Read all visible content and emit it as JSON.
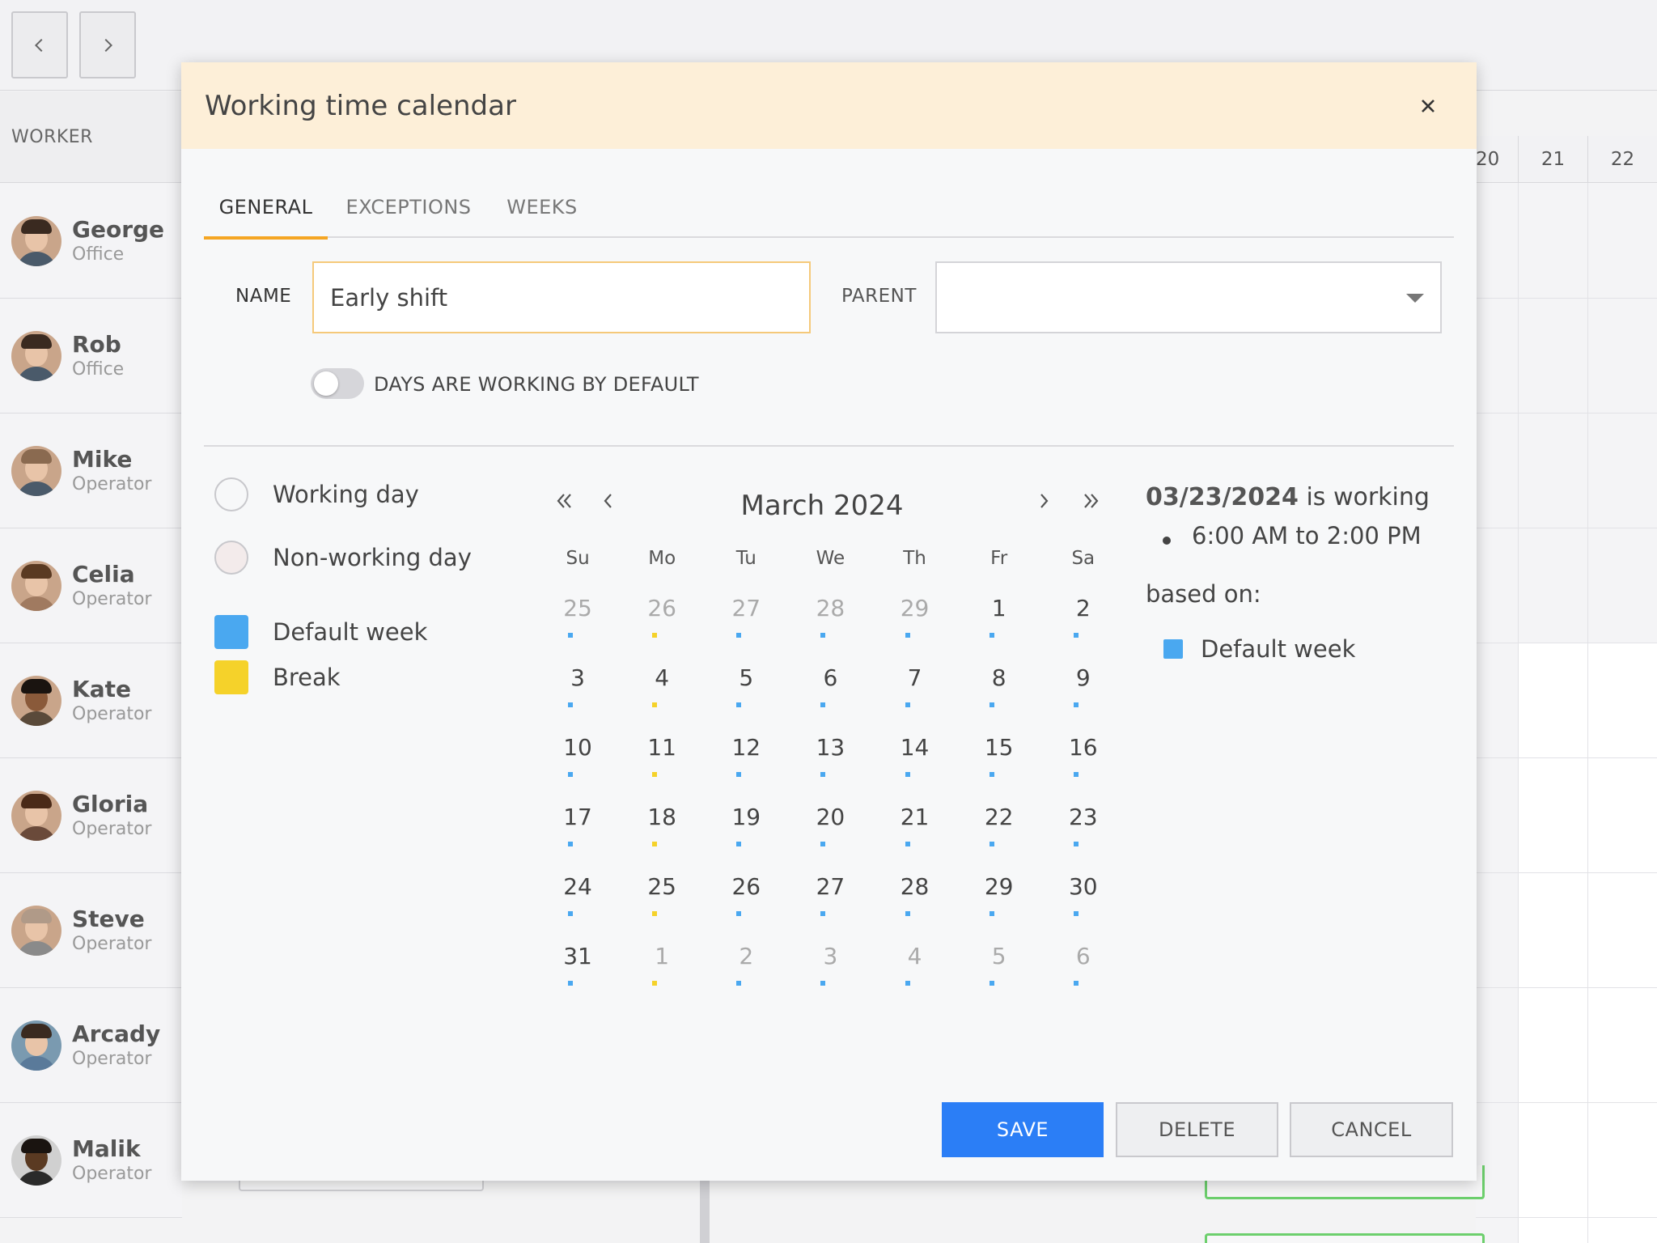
{
  "scheduler": {
    "worker_header": "WORKER",
    "date_headers": [
      "20",
      "21",
      "22"
    ],
    "workers": [
      {
        "name": "George",
        "role": "Office"
      },
      {
        "name": "Rob",
        "role": "Office"
      },
      {
        "name": "Mike",
        "role": "Operator"
      },
      {
        "name": "Celia",
        "role": "Operator"
      },
      {
        "name": "Kate",
        "role": "Operator"
      },
      {
        "name": "Gloria",
        "role": "Operator"
      },
      {
        "name": "Steve",
        "role": "Operator"
      },
      {
        "name": "Arcady",
        "role": "Operator"
      },
      {
        "name": "Malik",
        "role": "Operator"
      }
    ]
  },
  "dialog": {
    "title": "Working time calendar",
    "tabs": [
      "GENERAL",
      "EXCEPTIONS",
      "WEEKS"
    ],
    "active_tab": "GENERAL",
    "name_label": "NAME",
    "name_value": "Early shift",
    "parent_label": "PARENT",
    "parent_value": "",
    "toggle_label": "DAYS ARE WORKING BY DEFAULT",
    "toggle_on": false,
    "legend": {
      "working_day": "Working day",
      "non_working_day": "Non-working day",
      "default_week": "Default week",
      "break": "Break"
    },
    "colors": {
      "default_week": "#4aa8f0",
      "break": "#f5d22a",
      "accent": "#f5a623",
      "save": "#2b7ef6",
      "header_bg": "#fdefd8"
    },
    "calendar": {
      "month_title": "March 2024",
      "days_of_week": [
        "Su",
        "Mo",
        "Tu",
        "We",
        "Th",
        "Fr",
        "Sa"
      ],
      "weeks": [
        [
          {
            "d": "25",
            "other": true
          },
          {
            "d": "26",
            "other": true
          },
          {
            "d": "27",
            "other": true
          },
          {
            "d": "28",
            "other": true
          },
          {
            "d": "29",
            "other": true
          },
          {
            "d": "1"
          },
          {
            "d": "2"
          }
        ],
        [
          {
            "d": "3"
          },
          {
            "d": "4"
          },
          {
            "d": "5"
          },
          {
            "d": "6"
          },
          {
            "d": "7"
          },
          {
            "d": "8"
          },
          {
            "d": "9"
          }
        ],
        [
          {
            "d": "10"
          },
          {
            "d": "11"
          },
          {
            "d": "12"
          },
          {
            "d": "13"
          },
          {
            "d": "14"
          },
          {
            "d": "15"
          },
          {
            "d": "16"
          }
        ],
        [
          {
            "d": "17"
          },
          {
            "d": "18"
          },
          {
            "d": "19"
          },
          {
            "d": "20"
          },
          {
            "d": "21"
          },
          {
            "d": "22"
          },
          {
            "d": "23"
          }
        ],
        [
          {
            "d": "24"
          },
          {
            "d": "25"
          },
          {
            "d": "26"
          },
          {
            "d": "27"
          },
          {
            "d": "28"
          },
          {
            "d": "29"
          },
          {
            "d": "30"
          }
        ],
        [
          {
            "d": "31"
          },
          {
            "d": "1",
            "other": true
          },
          {
            "d": "2",
            "other": true
          },
          {
            "d": "3",
            "other": true
          },
          {
            "d": "4",
            "other": true
          },
          {
            "d": "5",
            "other": true
          },
          {
            "d": "6",
            "other": true
          }
        ]
      ],
      "break_column": "Mo"
    },
    "info": {
      "date": "03/23/2024",
      "date_suffix": " is working",
      "time_range": "6:00 AM to 2:00 PM",
      "based_on": "based on:",
      "week_name": "Default week"
    },
    "buttons": {
      "save": "SAVE",
      "delete": "DELETE",
      "cancel": "CANCEL"
    }
  }
}
